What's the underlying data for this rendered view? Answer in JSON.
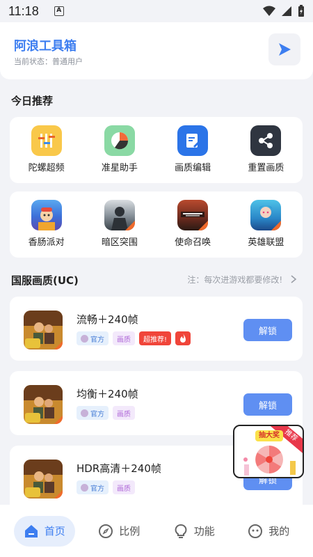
{
  "status_bar": {
    "time": "11:18",
    "notification_icon": "A"
  },
  "header": {
    "title": "阿浪工具箱",
    "subtitle": "当前状态：普通用户"
  },
  "today": {
    "title": "今日推荐",
    "tools": [
      {
        "label": "陀螺超频"
      },
      {
        "label": "准星助手"
      },
      {
        "label": "画质编辑"
      },
      {
        "label": "重置画质"
      }
    ],
    "games": [
      {
        "label": "香肠派对"
      },
      {
        "label": "暗区突围"
      },
      {
        "label": "使命召唤"
      },
      {
        "label": "英雄联盟"
      }
    ]
  },
  "uc": {
    "title": "国服画质(UC)",
    "note": "注：每次进游戏都要修改!",
    "items": [
      {
        "name": "流畅＋240帧",
        "tag_official": "官方",
        "tag_quality": "画质",
        "tag_hot": "超推荐!",
        "button": "解锁"
      },
      {
        "name": "均衡＋240帧",
        "tag_official": "官方",
        "tag_quality": "画质",
        "button": "解锁"
      },
      {
        "name": "HDR高清＋240帧",
        "tag_official": "官方",
        "tag_quality": "画质",
        "button": "解锁"
      }
    ]
  },
  "popup": {
    "badge": "推荐",
    "title": "抽大奖"
  },
  "tabbar": [
    {
      "label": "首页"
    },
    {
      "label": "比例"
    },
    {
      "label": "功能"
    },
    {
      "label": "我的"
    }
  ],
  "colors": {
    "accent": "#3d7ef0",
    "unlock": "#5f8ff2",
    "hot": "#f0453a"
  }
}
